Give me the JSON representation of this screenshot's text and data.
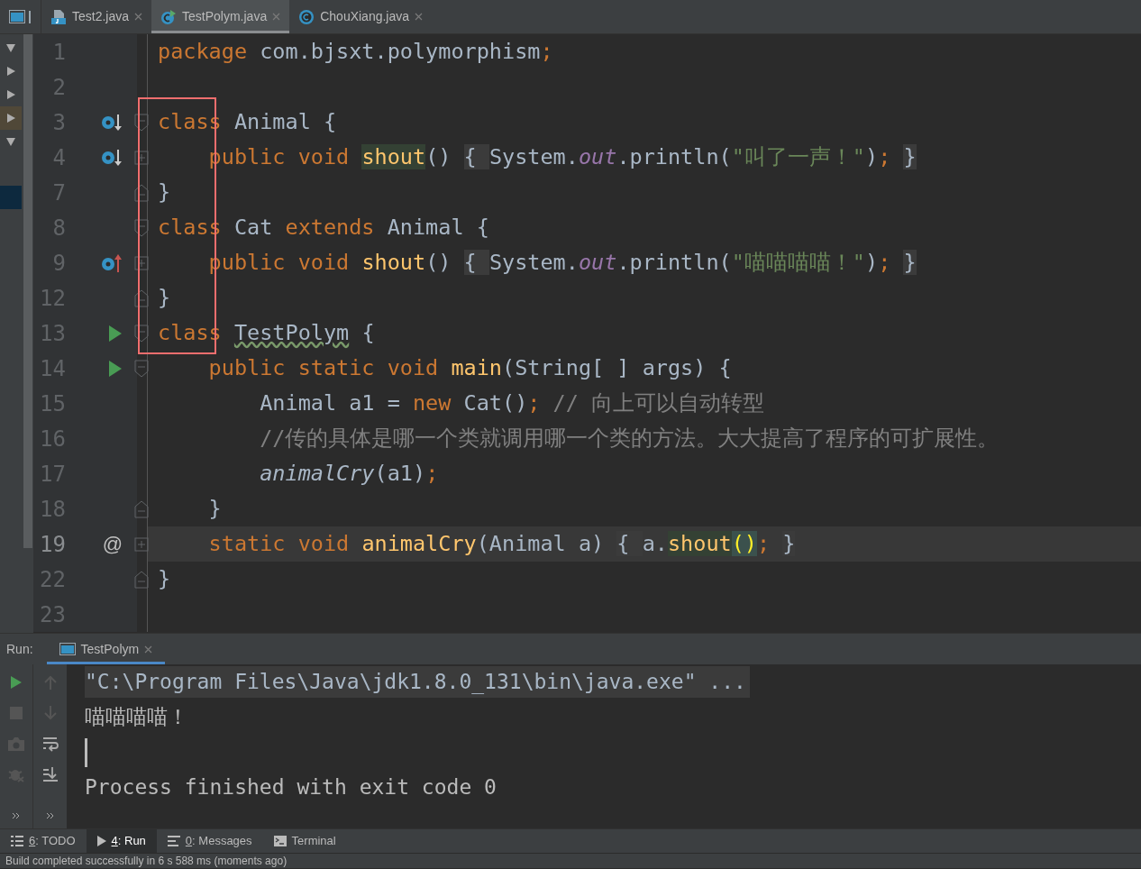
{
  "editor_tabs": [
    {
      "label": "Test2.java",
      "kind": "java",
      "selected": false
    },
    {
      "label": "TestPolym.java",
      "kind": "runnable",
      "selected": true
    },
    {
      "label": "ChouXiang.java",
      "kind": "class",
      "selected": false
    }
  ],
  "structure_arrows": [
    {
      "expanded": true
    },
    {
      "expanded": false
    },
    {
      "expanded": false
    },
    {
      "expanded": false
    },
    {
      "expanded": true
    }
  ],
  "code_lines": [
    {
      "number": "1",
      "current": false,
      "tokens": [
        {
          "text": "package ",
          "kind": "kw"
        },
        {
          "text": "com.bjsxt.polymorphism",
          "kind": "plain"
        },
        {
          "text": ";",
          "kind": "kw"
        }
      ]
    },
    {
      "number": "2",
      "current": false
    },
    {
      "number": "3",
      "gutter": {
        "kind": "overridden"
      },
      "fold": {
        "kind": "start"
      },
      "current": false,
      "tokens": [
        {
          "text": "class ",
          "kind": "kw"
        },
        {
          "text": "Animal {",
          "kind": "plain"
        }
      ]
    },
    {
      "number": "4",
      "gutter": {
        "kind": "overridden"
      },
      "fold": {
        "kind": "collapsed"
      },
      "current": false,
      "tokens": [
        {
          "text": "    public void ",
          "kind": "kw"
        },
        {
          "text": "shout",
          "kind": "usage"
        },
        {
          "text": "() ",
          "kind": "plain"
        },
        {
          "text": "{ ",
          "kind": "fold"
        },
        {
          "text": "System.",
          "kind": "plain"
        },
        {
          "text": "out",
          "kind": "field"
        },
        {
          "text": ".println(",
          "kind": "plain"
        },
        {
          "text": "\"叫了一声！\"",
          "kind": "str"
        },
        {
          "text": ")",
          "kind": "plain"
        },
        {
          "text": "; ",
          "kind": "kw"
        },
        {
          "text": "}",
          "kind": "fold"
        }
      ]
    },
    {
      "number": "7",
      "fold": {
        "kind": "end"
      },
      "current": false,
      "tokens": [
        {
          "text": "}",
          "kind": "plain"
        }
      ]
    },
    {
      "number": "8",
      "fold": {
        "kind": "start"
      },
      "current": false,
      "tokens": [
        {
          "text": "class ",
          "kind": "kw"
        },
        {
          "text": "Cat ",
          "kind": "plain"
        },
        {
          "text": "extends ",
          "kind": "kw"
        },
        {
          "text": "Animal {",
          "kind": "plain"
        }
      ]
    },
    {
      "number": "9",
      "gutter": {
        "kind": "overrides"
      },
      "fold": {
        "kind": "collapsed"
      },
      "current": false,
      "tokens": [
        {
          "text": "    public void ",
          "kind": "kw"
        },
        {
          "text": "shout",
          "kind": "fn"
        },
        {
          "text": "() ",
          "kind": "plain"
        },
        {
          "text": "{ ",
          "kind": "fold"
        },
        {
          "text": "System.",
          "kind": "plain"
        },
        {
          "text": "out",
          "kind": "field"
        },
        {
          "text": ".println(",
          "kind": "plain"
        },
        {
          "text": "\"喵喵喵喵！\"",
          "kind": "str"
        },
        {
          "text": ")",
          "kind": "plain"
        },
        {
          "text": "; ",
          "kind": "kw"
        },
        {
          "text": "}",
          "kind": "fold"
        }
      ]
    },
    {
      "number": "12",
      "fold": {
        "kind": "end"
      },
      "current": false,
      "tokens": [
        {
          "text": "}",
          "kind": "plain"
        }
      ]
    },
    {
      "number": "13",
      "gutter": {
        "kind": "run"
      },
      "fold": {
        "kind": "start"
      },
      "current": false,
      "tokens": [
        {
          "text": "class ",
          "kind": "kw"
        },
        {
          "text": "TestPolym",
          "kind": "typo"
        },
        {
          "text": " {",
          "kind": "plain"
        }
      ]
    },
    {
      "number": "14",
      "gutter": {
        "kind": "run"
      },
      "fold": {
        "kind": "start"
      },
      "current": false,
      "tokens": [
        {
          "text": "    public static void ",
          "kind": "kw"
        },
        {
          "text": "main",
          "kind": "fn"
        },
        {
          "text": "(String[ ] args) {",
          "kind": "plain"
        }
      ]
    },
    {
      "number": "15",
      "current": false,
      "tokens": [
        {
          "text": "        Animal a1 = ",
          "kind": "plain"
        },
        {
          "text": "new ",
          "kind": "kw"
        },
        {
          "text": "Cat()",
          "kind": "plain"
        },
        {
          "text": "; ",
          "kind": "kw"
        },
        {
          "text": "// 向上可以自动转型",
          "kind": "cmt"
        }
      ]
    },
    {
      "number": "16",
      "current": false,
      "tokens": [
        {
          "text": "        //传的具体是哪一个类就调用哪一个类的方法。大大提高了程序的可扩展性。",
          "kind": "cmt"
        }
      ]
    },
    {
      "number": "17",
      "current": false,
      "tokens": [
        {
          "text": "        animalCry",
          "kind": "ital"
        },
        {
          "text": "(a1)",
          "kind": "plain"
        },
        {
          "text": ";",
          "kind": "kw"
        }
      ]
    },
    {
      "number": "18",
      "fold": {
        "kind": "end"
      },
      "current": false,
      "tokens": [
        {
          "text": "    }",
          "kind": "plain"
        }
      ]
    },
    {
      "number": "19",
      "gutter": {
        "kind": "text",
        "text": "@"
      },
      "fold": {
        "kind": "collapsed"
      },
      "current": true,
      "tokens": [
        {
          "text": "    static void ",
          "kind": "kw"
        },
        {
          "text": "animalCry",
          "kind": "fn"
        },
        {
          "text": "(Animal a) ",
          "kind": "plain"
        },
        {
          "text": "{ ",
          "kind": "fold"
        },
        {
          "text": "a.",
          "kind": "plain"
        },
        {
          "text": "shout",
          "kind": "usage"
        },
        {
          "text": "()",
          "kind": "brace"
        },
        {
          "text": "; ",
          "kind": "kw"
        },
        {
          "text": "}",
          "kind": "fold"
        }
      ]
    },
    {
      "number": "22",
      "fold": {
        "kind": "end"
      },
      "current": false,
      "tokens": [
        {
          "text": "}",
          "kind": "plain"
        }
      ]
    },
    {
      "number": "23",
      "current": false
    }
  ],
  "run_panel": {
    "label": "Run:",
    "tab": {
      "label": "TestPolym",
      "selected": true
    },
    "console_lines": [
      {
        "text": "\"C:\\Program Files\\Java\\jdk1.8.0_131\\bin\\java.exe\" ...",
        "kind": "command"
      },
      {
        "text": "喵喵喵喵！",
        "kind": "output"
      },
      {
        "kind": "caret"
      },
      {
        "text": "Process finished with exit code 0",
        "kind": "output"
      }
    ]
  },
  "tool_tabs": [
    {
      "mnemonic": "6",
      "label": ": TODO",
      "kind": "list",
      "selected": false
    },
    {
      "mnemonic": "4",
      "label": ": Run",
      "kind": "play",
      "selected": true
    },
    {
      "mnemonic": "0",
      "label": ": Messages",
      "kind": "messages",
      "selected": false
    },
    {
      "label": "Terminal",
      "kind": "terminal",
      "selected": false
    }
  ],
  "status_bar": "Build completed successfully in 6 s 588 ms (moments ago)"
}
